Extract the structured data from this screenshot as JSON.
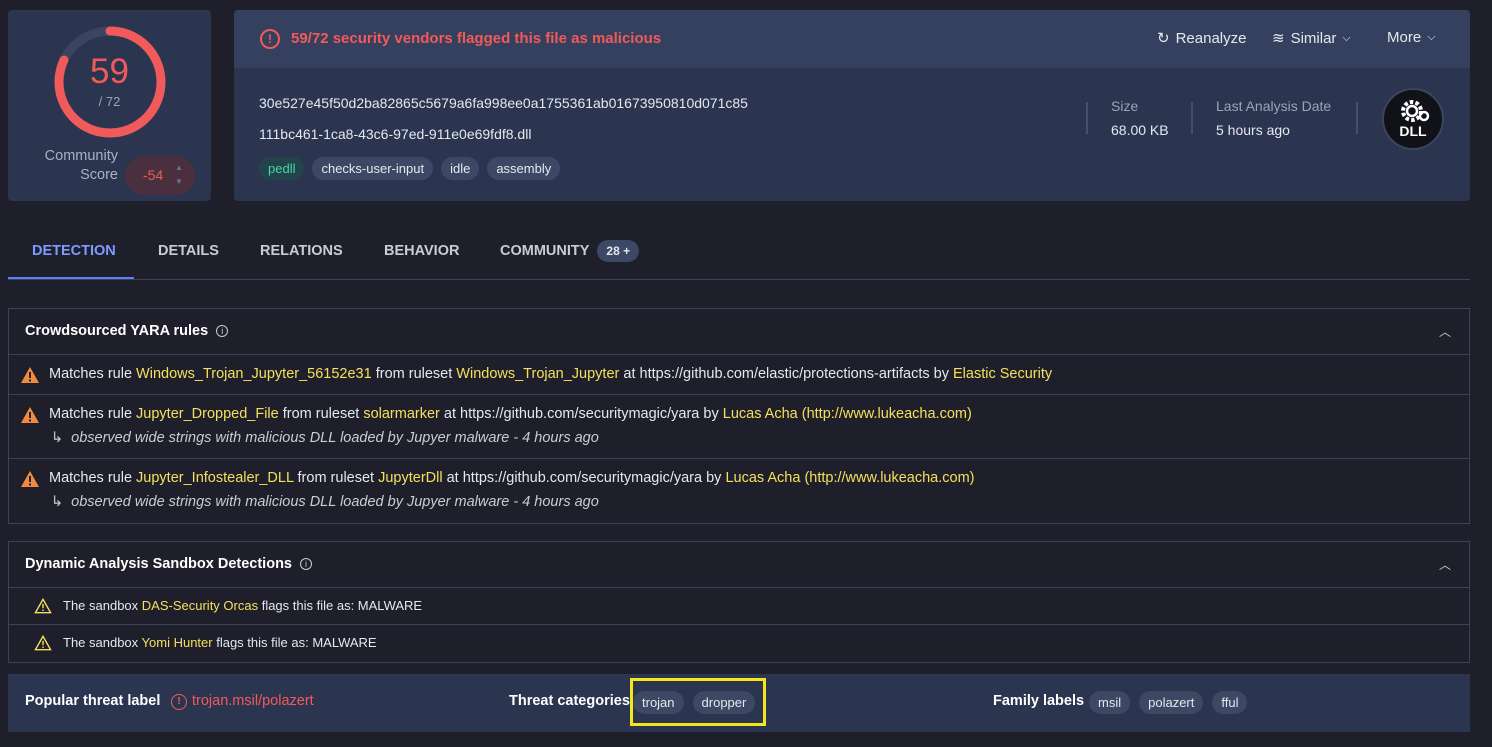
{
  "score": {
    "detections": "59",
    "total": "/ 72",
    "ratio": 0.8194,
    "community_label_1": "Community",
    "community_label_2": "Score",
    "community_value": "-54"
  },
  "header": {
    "alert_text": "59/72 security vendors flagged this file as malicious",
    "reanalyze_label": "Reanalyze",
    "similar_label": "Similar",
    "more_label": "More",
    "hash": "30e527e45f50d2ba82865c5679a6fa998ee0a1755361ab01673950810d071c85",
    "filename": "111bc461-1ca8-43c6-97ed-911e0e69fdf8.dll",
    "tags": [
      "pedll",
      "checks-user-input",
      "idle",
      "assembly"
    ],
    "size_label": "Size",
    "size_value": "68.00 KB",
    "last_analysis_label": "Last Analysis Date",
    "last_analysis_value": "5 hours ago",
    "file_type": "DLL"
  },
  "tabs": [
    {
      "label": "DETECTION",
      "active": true
    },
    {
      "label": "DETAILS"
    },
    {
      "label": "RELATIONS"
    },
    {
      "label": "BEHAVIOR"
    },
    {
      "label": "COMMUNITY",
      "badge": "28 +"
    }
  ],
  "yara": {
    "title": "Crowdsourced YARA rules",
    "rows": [
      {
        "p1": "Matches rule ",
        "rule": "Windows_Trojan_Jupyter_56152e31",
        "p2": " from ruleset ",
        "ruleset": "Windows_Trojan_Jupyter",
        "p3": " at https://github.com/elastic/protections-artifacts by ",
        "author": "Elastic Security"
      },
      {
        "p1": "Matches rule ",
        "rule": "Jupyter_Dropped_File",
        "p2": " from ruleset ",
        "ruleset": "solarmarker",
        "p3": " at https://github.com/securitymagic/yara by ",
        "author": "Lucas Acha (http://www.lukeacha.com)",
        "note": "observed wide strings with malicious DLL loaded by Jupyer malware - 4 hours ago"
      },
      {
        "p1": "Matches rule ",
        "rule": "Jupyter_Infostealer_DLL",
        "p2": " from ruleset ",
        "ruleset": "JupyterDll",
        "p3": " at https://github.com/securitymagic/yara by ",
        "author": "Lucas Acha (http://www.lukeacha.com)",
        "note": "observed wide strings with malicious DLL loaded by Jupyer malware - 4 hours ago"
      }
    ]
  },
  "sandbox": {
    "title": "Dynamic Analysis Sandbox Detections",
    "rows": [
      {
        "p1": "The sandbox ",
        "name": "DAS-Security Orcas",
        "p2": " flags this file as: MALWARE"
      },
      {
        "p1": "The sandbox ",
        "name": "Yomi Hunter",
        "p2": " flags this file as: MALWARE"
      }
    ]
  },
  "bottom": {
    "threat_label": "Popular threat label",
    "threat_value": "trojan.msil/polazert",
    "categories_label": "Threat categories",
    "categories": [
      "trojan",
      "dropper"
    ],
    "family_label": "Family labels",
    "families": [
      "msil",
      "polazert",
      "fful"
    ]
  },
  "colors": {
    "danger": "#f15a5a",
    "highlight_text": "#f4e05c",
    "accent": "#7d9cff",
    "annotation_box": "#f5e51b",
    "card": "#2b3550"
  }
}
